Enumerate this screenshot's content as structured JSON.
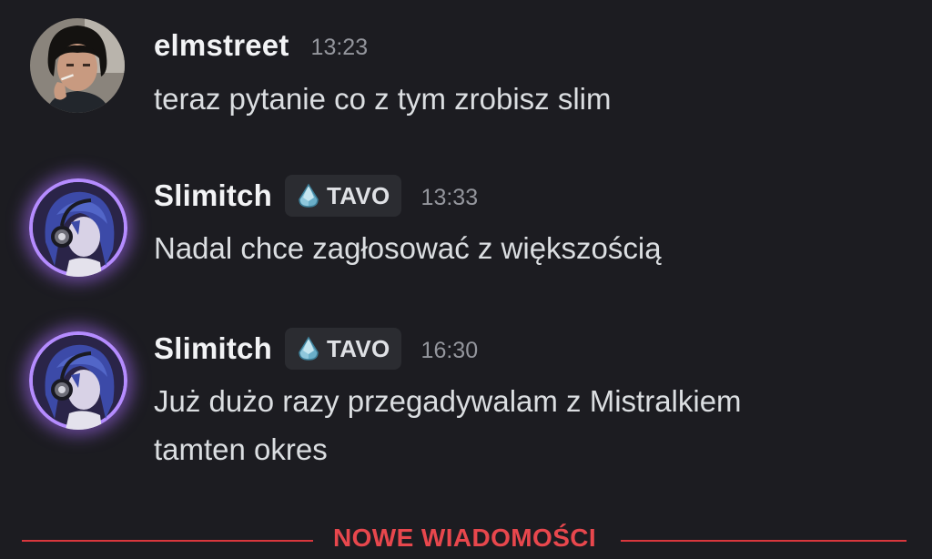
{
  "messages": [
    {
      "avatar_icon": "user-avatar-photo",
      "username": "elmstreet",
      "tag": null,
      "timestamp": "13:23",
      "text": "teraz pytanie co z tym zrobisz slim"
    },
    {
      "avatar_icon": "anime-avatar",
      "username": "Slimitch",
      "tag": {
        "icon": "crystal-drop-icon",
        "label": "TAVO"
      },
      "timestamp": "13:33",
      "text": "Nadal chce zagłosować z większością"
    },
    {
      "avatar_icon": "anime-avatar",
      "username": "Slimitch",
      "tag": {
        "icon": "crystal-drop-icon",
        "label": "TAVO"
      },
      "timestamp": "16:30",
      "text": "Już dużo razy przegadywalam z Mistralkiem\ntamten okres"
    }
  ],
  "new_messages_divider": {
    "label": "NOWE WIADOMOŚCI",
    "color": "#e8474d"
  },
  "colors": {
    "background": "#1c1c21",
    "username": "#f2f3f5",
    "message_text": "#dbdee1",
    "timestamp": "#94969d",
    "tag_background": "#2b2c31",
    "avatar_glow": "#b58cff"
  }
}
